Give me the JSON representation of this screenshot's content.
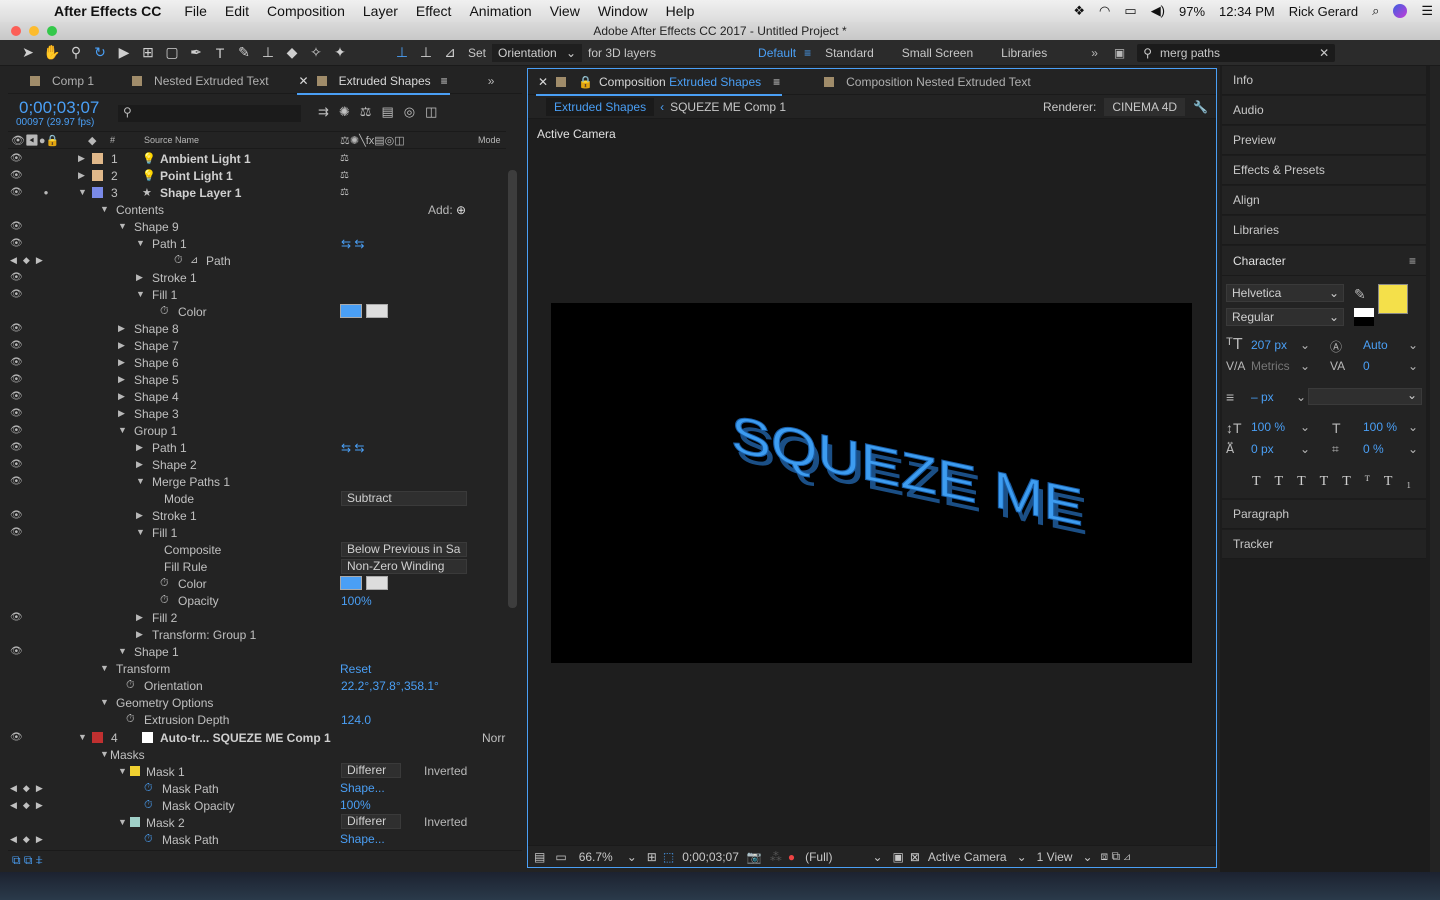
{
  "menubar": {
    "app": "After Effects CC",
    "items": [
      "File",
      "Edit",
      "Composition",
      "Layer",
      "Effect",
      "Animation",
      "View",
      "Window",
      "Help"
    ],
    "battery": "97%",
    "time": "12:34 PM",
    "user": "Rick Gerard"
  },
  "window": {
    "title": "Adobe After Effects CC 2017 - Untitled Project *"
  },
  "toolbar": {
    "set": "Set",
    "orientation": "Orientation",
    "for3d": "for 3D layers",
    "workspaces": [
      "Default",
      "Standard",
      "Small Screen",
      "Libraries"
    ],
    "search": "merg paths"
  },
  "timeline": {
    "tabs": [
      "Comp 1",
      "Nested Extruded Text",
      "Extruded Shapes"
    ],
    "timecode": "0;00;03;07",
    "frames": "00097 (29.97 fps)",
    "search_placeholder": "",
    "header": {
      "num": "#",
      "source": "Source Name",
      "mode": "Mode"
    },
    "layers": [
      {
        "n": "1",
        "name": "Ambient Light 1",
        "color": "#e0b88a"
      },
      {
        "n": "2",
        "name": "Point Light 1",
        "color": "#e0b88a"
      },
      {
        "n": "3",
        "name": "Shape Layer 1",
        "color": "#7a8ae8"
      }
    ],
    "tree": [
      "Contents",
      "Shape 9",
      "Path 1",
      "Path",
      "Stroke 1",
      "Fill 1",
      "Color",
      "Shape 8",
      "Shape 7",
      "Shape 6",
      "Shape 5",
      "Shape 4",
      "Shape 3",
      "Group 1",
      "Path 1",
      "Shape 2",
      "Merge Paths 1",
      "Mode",
      "Stroke 1",
      "Fill 1",
      "Composite",
      "Fill Rule",
      "Color",
      "Opacity",
      "Fill 2",
      "Transform: Group 1",
      "Shape 1",
      "Transform",
      "Orientation",
      "Geometry Options",
      "Extrusion Depth"
    ],
    "add": "Add:",
    "mode_val": "Subtract",
    "composite_val": "Below Previous in Sa",
    "fillrule_val": "Non-Zero Winding",
    "opacity_val": "100%",
    "reset": "Reset",
    "orient_val": "22.2°,37.8°,358.1°",
    "extrusion_val": "124.0",
    "layer4": {
      "n": "4",
      "name": "Auto-tr... SQUEZE ME Comp 1",
      "mode": "Norr"
    },
    "masks": "Masks",
    "mask1": "Mask 1",
    "mask2": "Mask 2",
    "mask_mode": "Differer",
    "inverted": "Inverted",
    "mask_path": "Mask Path",
    "mask_opacity": "Mask Opacity",
    "shape_val": "Shape...",
    "mask_op_val": "100%"
  },
  "comp": {
    "tab1": "Composition",
    "tab1b": "Extruded Shapes",
    "tab2": "Composition Nested Extruded Text",
    "crumb1": "Extruded Shapes",
    "crumb2": "SQUEZE ME Comp 1",
    "renderer_label": "Renderer:",
    "renderer": "CINEMA 4D",
    "view_label": "Active Camera",
    "text": "SQUEZE ME",
    "footer": {
      "zoom": "66.7%",
      "time": "0;00;03;07",
      "res": "(Full)",
      "camera": "Active Camera",
      "views": "1 View"
    }
  },
  "right": {
    "panels": [
      "Info",
      "Audio",
      "Preview",
      "Effects & Presets",
      "Align",
      "Libraries"
    ],
    "character": "Character",
    "font": "Helvetica",
    "style": "Regular",
    "size": "207 px",
    "leading": "Auto",
    "kerning": "Metrics",
    "tracking": "0",
    "stroke": "– px",
    "vscale": "100 %",
    "hscale": "100 %",
    "baseline": "0 px",
    "tsume": "0 %",
    "fill_color": "#f4e04a",
    "bottom": [
      "Paragraph",
      "Tracker"
    ]
  }
}
